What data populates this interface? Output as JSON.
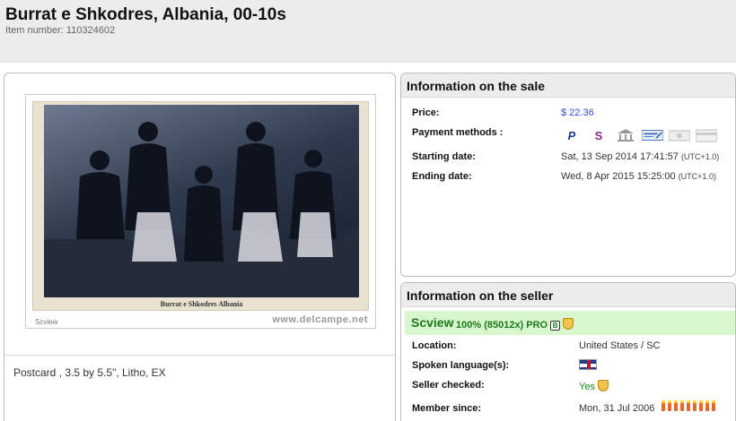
{
  "header": {
    "title": "Burrat e Shkodres, Albania, 00-10s",
    "item_number": "Item number: 110324602"
  },
  "photo": {
    "caption": "Burrat e Shkodres Albania",
    "seller_label": "Scview",
    "watermark": "www.delcampe.net"
  },
  "description": "Postcard , 3.5 by 5.5\", Litho, EX",
  "sale": {
    "heading": "Information on the sale",
    "price_label": "Price:",
    "price_value": "$ 22.36",
    "payment_label": "Payment methods :",
    "payment_icons": [
      "paypal-icon",
      "skrill-icon",
      "bank-icon",
      "check-icon",
      "cash-icon",
      "card-icon"
    ],
    "start_label": "Starting date:",
    "start_value": "Sat, 13 Sep 2014 17:41:57",
    "start_tz": "(UTC+1.0)",
    "end_label": "Ending date:",
    "end_value": "Wed, 8 Apr 2015 15:25:00",
    "end_tz": "(UTC+1.0)"
  },
  "seller": {
    "heading": "Information on the seller",
    "name": "Scview",
    "score": "100% (85012x) PRO",
    "location_label": "Location:",
    "location_value": "United States / SC",
    "language_label": "Spoken language(s):",
    "checked_label": "Seller checked:",
    "checked_value": "Yes",
    "member_label": "Member since:",
    "member_value": "Mon, 31 Jul 2006"
  },
  "colors": {
    "header_bg": "#ececec",
    "price": "#2b4fd8",
    "seller_green": "#1a7a1a",
    "seller_bar": "#d9f7cf"
  }
}
